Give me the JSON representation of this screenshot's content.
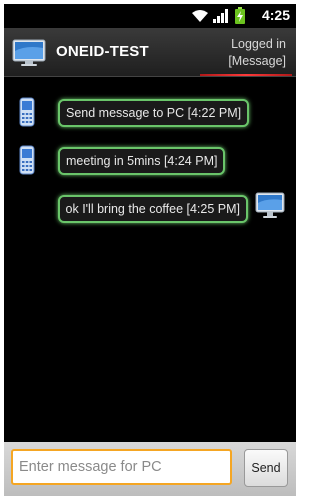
{
  "status_bar": {
    "time": "4:25",
    "icons": [
      "wifi-icon",
      "signal-icon",
      "battery-charging-icon"
    ]
  },
  "header": {
    "app_title": "ONEID-TEST",
    "status_line1": "Logged in",
    "status_line2": "[Message]",
    "accent_color": "#e02020"
  },
  "messages": [
    {
      "sender": "phone",
      "text": "Send message to PC [4:22 PM]",
      "icon": "phone-icon"
    },
    {
      "sender": "phone",
      "text": "meeting in 5mins [4:24 PM]",
      "icon": "phone-icon"
    },
    {
      "sender": "pc",
      "text": "ok I'll bring the coffee [4:25 PM]",
      "icon": "monitor-icon"
    }
  ],
  "compose": {
    "placeholder": "Enter message for PC",
    "value": "",
    "send_label": "Send",
    "focus_color": "#f5a623"
  },
  "colors": {
    "bubble_border": "#6ac56a",
    "background": "#000000"
  }
}
